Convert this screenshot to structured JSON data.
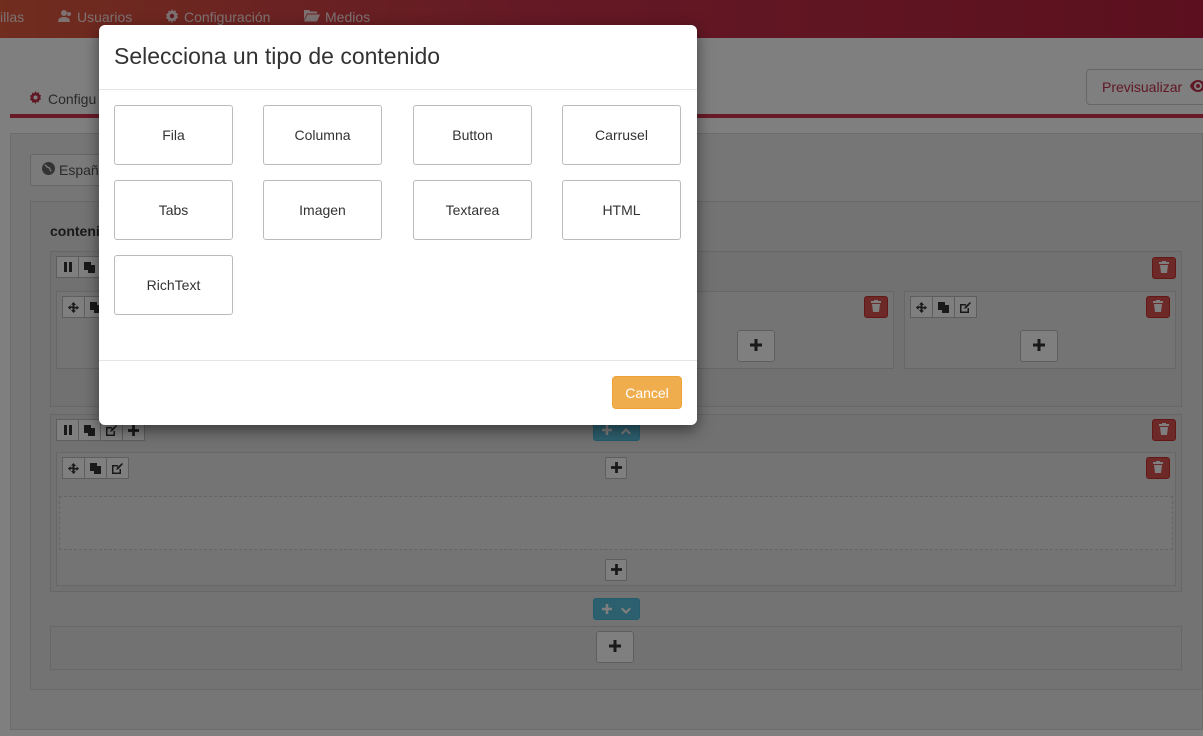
{
  "nav": {
    "items": [
      {
        "label": "illas",
        "icon": "none"
      },
      {
        "label": "Usuarios",
        "icon": "users-icon"
      },
      {
        "label": "Configuración",
        "icon": "gear-icon"
      },
      {
        "label": "Medios",
        "icon": "folder-open-icon"
      }
    ]
  },
  "header": {
    "config_tab": "Configu",
    "preview_button": "Previsualizar"
  },
  "editor": {
    "language_tab": "Españ",
    "content_label": "conteni"
  },
  "modal": {
    "title": "Selecciona un tipo de contenido",
    "content_types": [
      "Fila",
      "Columna",
      "Button",
      "Carrusel",
      "Tabs",
      "Imagen",
      "Textarea",
      "HTML",
      "RichText"
    ],
    "cancel_label": "Cancel"
  },
  "colors": {
    "nav_gradient_start": "#e25a3d",
    "nav_gradient_end": "#b8213e",
    "accent": "#d3354e",
    "danger": "#d9534f",
    "info": "#5bc0de",
    "warning": "#f0ad4e"
  }
}
